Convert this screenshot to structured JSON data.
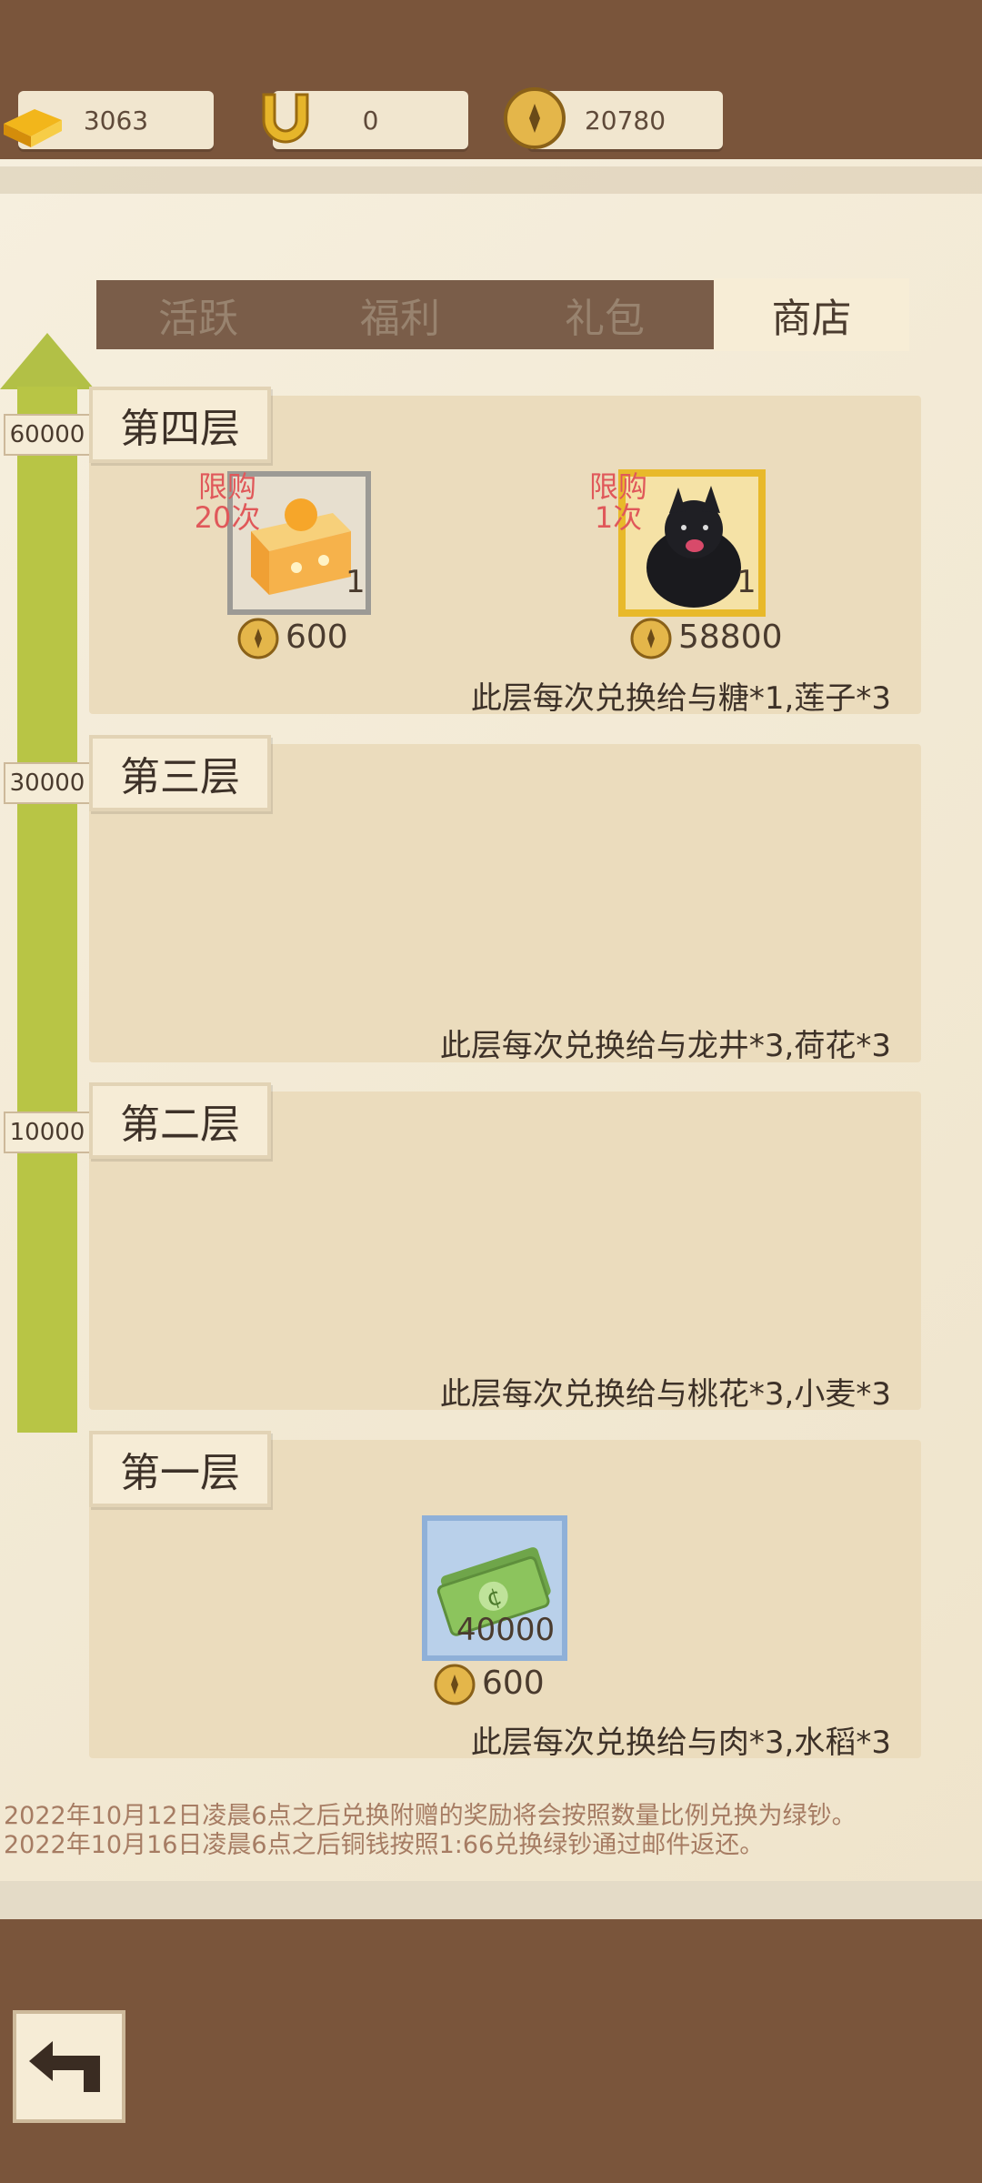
{
  "currency": {
    "gold": {
      "icon": "gold-bar-icon",
      "value": "3063"
    },
    "horseshoe": {
      "icon": "horseshoe-icon",
      "value": "0"
    },
    "coin": {
      "icon": "copper-coin-icon",
      "value": "20780"
    }
  },
  "tabs": [
    {
      "label": "活跃",
      "active": false
    },
    {
      "label": "福利",
      "active": false
    },
    {
      "label": "礼包",
      "active": false
    },
    {
      "label": "商店",
      "active": true
    }
  ],
  "progress": {
    "labels": [
      "60000",
      "30000",
      "10000"
    ]
  },
  "layers": [
    {
      "title": "第四层",
      "note": "此层每次兑换给与糖*1,莲子*3",
      "items": [
        {
          "icon": "cake-icon",
          "limit": "限购\n20次",
          "limit_line1": "限购",
          "limit_line2": "20次",
          "qty": "1",
          "price": "600"
        },
        {
          "icon": "black-dog-icon",
          "limit_line1": "限购",
          "limit_line2": "1次",
          "qty": "1",
          "price": "58800"
        }
      ]
    },
    {
      "title": "第三层",
      "note": "此层每次兑换给与龙井*3,荷花*3"
    },
    {
      "title": "第二层",
      "note": "此层每次兑换给与桃花*3,小麦*3"
    },
    {
      "title": "第一层",
      "note": "此层每次兑换给与肉*3,水稻*3",
      "items": [
        {
          "icon": "green-cash-icon",
          "qty": "40000",
          "price": "600"
        }
      ]
    }
  ],
  "footnotes": [
    "2022年10月12日凌晨6点之后兑换附赠的奖励将会按照数量比例兑换为绿钞。",
    "2022年10月16日凌晨6点之后铜钱按照1:66兑换绿钞通过邮件返还。"
  ],
  "colors": {
    "background": "#7a553b",
    "panel": "#f3ead7",
    "progress": "#b8c545",
    "limit_text": "#e0585a"
  }
}
